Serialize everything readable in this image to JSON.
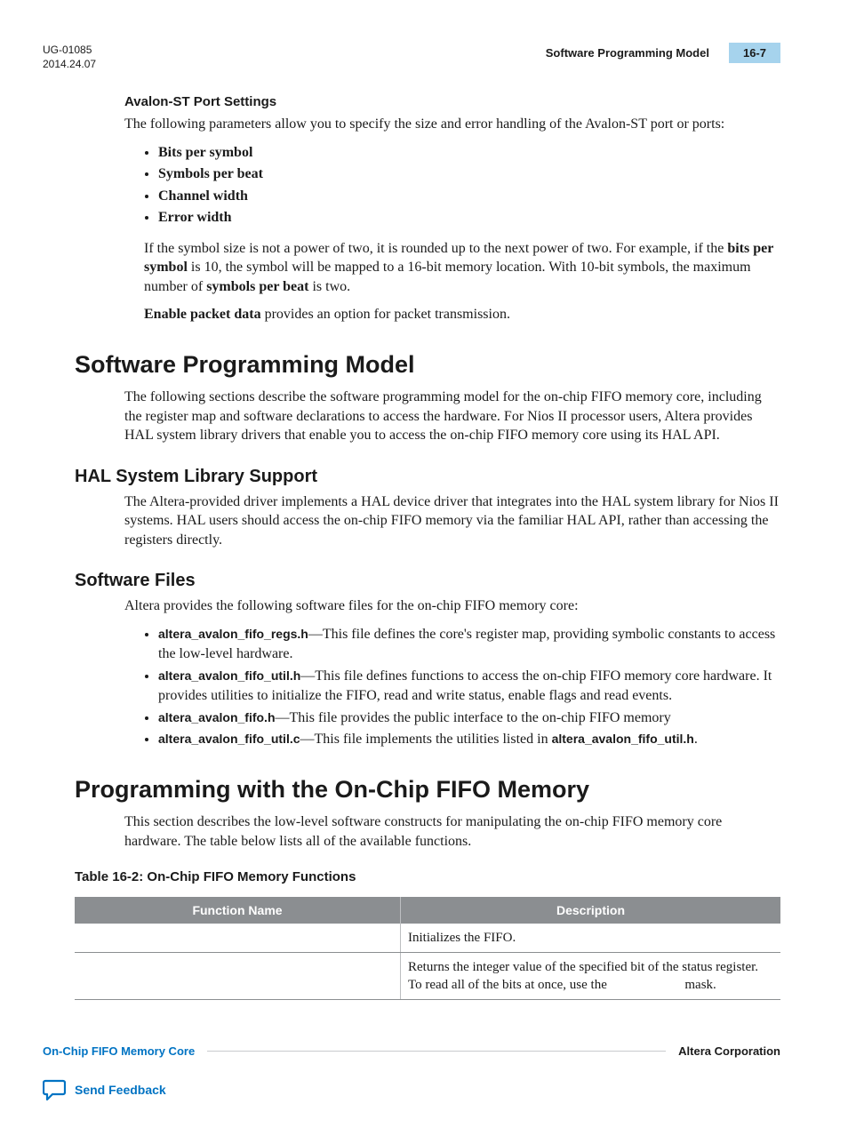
{
  "header": {
    "doc_id": "UG-01085",
    "date": "2014.24.07",
    "breadcrumb": "Software Programming Model",
    "page_number": "16-7"
  },
  "avalon_st": {
    "title": "Avalon-ST Port Settings",
    "intro": "The following parameters allow you to specify the size and error handling of the Avalon-ST port or ports:",
    "bullets": [
      "Bits per symbol",
      "Symbols per beat",
      "Channel width",
      "Error width"
    ],
    "para1_pre": "If the symbol size is not a power of two, it is rounded up to the next power of two. For example, if the ",
    "para1_bold1": "bits per symbol",
    "para1_mid": " is 10, the symbol will be mapped to a 16-bit memory location. With 10-bit symbols, the maximum number of ",
    "para1_bold2": "symbols per beat",
    "para1_end": " is two.",
    "para2_bold": "Enable packet data",
    "para2_rest": " provides an option for packet transmission."
  },
  "spm": {
    "title": "Software Programming Model",
    "intro": "The following sections describe the software programming model for the on-chip FIFO memory core, including the register map and software declarations to access the hardware. For Nios II processor users, Altera provides HAL system library drivers that enable you to access the on-chip FIFO memory core using its HAL API."
  },
  "hal": {
    "title": "HAL System Library Support",
    "body": "The Altera-provided driver implements a HAL device driver that integrates into the HAL system library for Nios II systems. HAL users should access the on-chip FIFO memory via the familiar HAL API, rather than accessing the registers directly."
  },
  "swfiles": {
    "title": "Software Files",
    "intro": "Altera provides the following software files for the on-chip FIFO memory core:",
    "items": [
      {
        "name": "altera_avalon_fifo_regs.h",
        "desc": "—This file defines the core's register map, providing symbolic constants to access the low-level hardware."
      },
      {
        "name": "altera_avalon_fifo_util.h",
        "desc": "—This file defines functions to access the on-chip FIFO memory core hardware. It provides utilities to initialize the FIFO, read and write status, enable flags and read events."
      },
      {
        "name": "altera_avalon_fifo.h",
        "desc": "—This file provides the public interface to the on-chip FIFO memory"
      },
      {
        "name": "altera_avalon_fifo_util.c",
        "desc_pre": "—This file implements the utilities listed in ",
        "desc_bold": "altera_avalon_fifo_util.h",
        "desc_post": "."
      }
    ]
  },
  "prog": {
    "title": "Programming with the On-Chip FIFO Memory",
    "intro": "This section describes the low-level software constructs for manipulating the on-chip FIFO memory core hardware. The table below lists all of the available functions."
  },
  "table": {
    "title": "Table 16-2: On-Chip FIFO Memory Functions",
    "headers": [
      "Function Name",
      "Description"
    ],
    "rows": [
      {
        "fn": "",
        "desc": "Initializes the FIFO."
      },
      {
        "fn": "",
        "desc_pre": "Returns the integer value of the specified bit of the status register. To read all of the bits at once, use the ",
        "desc_post": " mask."
      }
    ]
  },
  "footer": {
    "left_link": "On-Chip FIFO Memory Core",
    "right_text": "Altera Corporation",
    "feedback": "Send Feedback"
  }
}
